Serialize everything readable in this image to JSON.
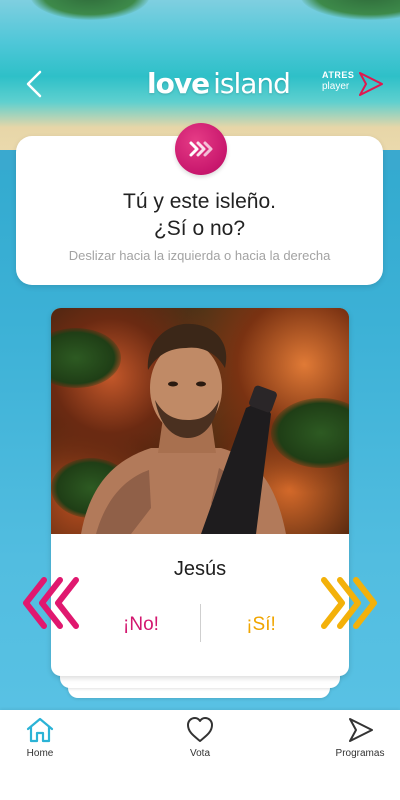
{
  "header": {
    "logo_part1": "love",
    "logo_part2": "island",
    "atres_line1": "ATRES",
    "atres_line2": "player"
  },
  "prompt": {
    "icon": "chevrons-right-icon",
    "title_line1": "Tú y este isleño.",
    "title_line2": "¿Sí o no?",
    "subtitle": "Deslizar hacia la izquierda o hacia la derecha"
  },
  "contestant": {
    "name": "Jesús",
    "no_label": "¡No!",
    "yes_label": "¡Sí!"
  },
  "nav": {
    "items": [
      {
        "label": "Home",
        "icon": "home-icon",
        "active": true
      },
      {
        "label": "Vota",
        "icon": "heart-icon",
        "active": false
      },
      {
        "label": "Programas",
        "icon": "play-arrow-icon",
        "active": false
      }
    ]
  },
  "colors": {
    "brand_pink": "#d3176f",
    "brand_yellow": "#f0a500",
    "accent_teal": "#2bb3d6"
  }
}
